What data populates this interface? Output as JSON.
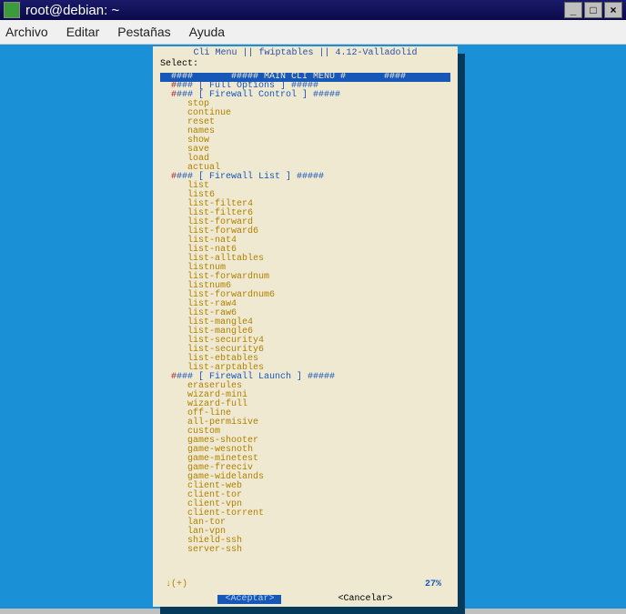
{
  "titlebar": {
    "title": "root@debian: ~"
  },
  "menubar": {
    "file": "Archivo",
    "edit": "Editar",
    "tabs": "Pestañas",
    "help": "Ayuda"
  },
  "dialog": {
    "header": "Cli Menu || fwiptables || 4.12-Valladolid",
    "select_label": "Select:",
    "highlight_text": "####       ##### MAIN CLI MENU #       ####",
    "sections": [
      {
        "marker": "#",
        "header": "### [ Full Options ] #####",
        "items": []
      },
      {
        "marker": "#",
        "header": "### [ Firewall Control ] #####",
        "items": [
          "stop",
          "continue",
          "reset",
          "names",
          "show",
          "save",
          "load",
          "actual"
        ]
      },
      {
        "marker": "#",
        "header": "### [ Firewall List ] #####",
        "items": [
          "list",
          "list6",
          "list-filter4",
          "list-filter6",
          "list-forward",
          "list-forward6",
          "list-nat4",
          "list-nat6",
          "list-alltables",
          "listnum",
          "list-forwardnum",
          "listnum6",
          "list-forwardnum6",
          "list-raw4",
          "list-raw6",
          "list-mangle4",
          "list-mangle6",
          "list-security4",
          "list-security6",
          "list-ebtables",
          "list-arptables"
        ]
      },
      {
        "marker": "#",
        "header": "### [ Firewall Launch ] #####",
        "items": [
          "eraserules",
          "wizard-mini",
          "wizard-full",
          "off-line",
          "all-permisive",
          "custom",
          "games-shooter",
          "game-wesnoth",
          "game-minetest",
          "game-freeciv",
          "game-widelands",
          "client-web",
          "client-tor",
          "client-vpn",
          "client-torrent",
          "lan-tor",
          "lan-vpn",
          "shield-ssh",
          "server-ssh"
        ]
      }
    ],
    "scroll_indicator": "↓(+)",
    "percent": "27%",
    "ok_label": "<Aceptar>",
    "cancel_label": "<Cancelar>"
  }
}
